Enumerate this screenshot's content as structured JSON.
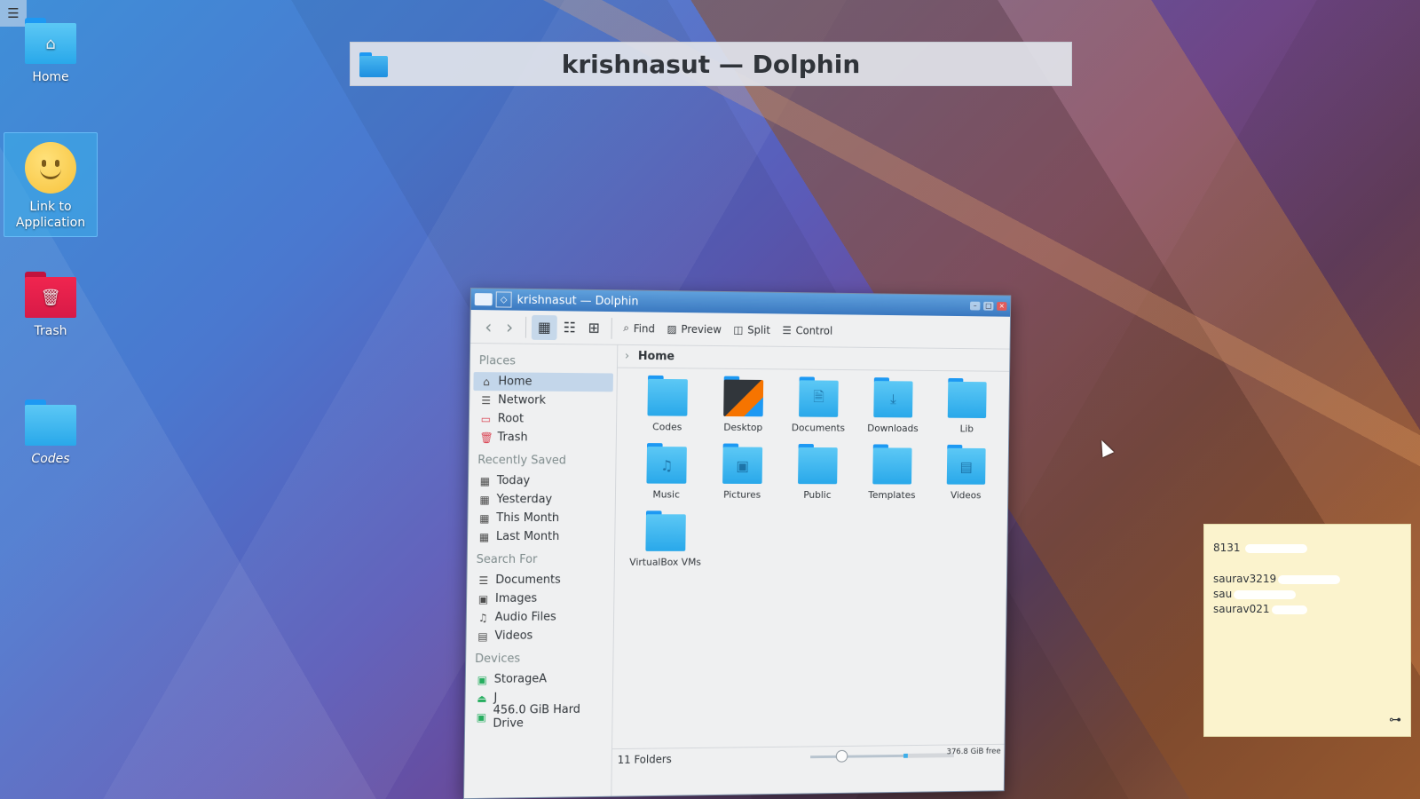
{
  "desktop": {
    "menu_icon": "hamburger-icon",
    "icons": [
      {
        "label": "Home",
        "icon": "home-folder-icon"
      },
      {
        "label": "Link to Application",
        "icon": "smiley-icon"
      },
      {
        "label": "Trash",
        "icon": "trash-folder-icon"
      },
      {
        "label": "Codes",
        "icon": "link-folder-icon"
      }
    ]
  },
  "switcher": {
    "title": "krishnasut — Dolphin",
    "icon": "folder-icon"
  },
  "window": {
    "title": "krishnasut — Dolphin",
    "toolbar": {
      "back": "back-arrow-icon",
      "forward": "forward-arrow-icon",
      "find": "Find",
      "preview": "Preview",
      "split": "Split",
      "control": "Control"
    },
    "places": {
      "header": "Places",
      "items": [
        "Home",
        "Network",
        "Root",
        "Trash"
      ],
      "recent_header": "Recently Saved",
      "recent": [
        "Today",
        "Yesterday",
        "This Month",
        "Last Month"
      ],
      "search_header": "Search For",
      "search": [
        "Documents",
        "Images",
        "Audio Files",
        "Videos"
      ],
      "devices_header": "Devices",
      "devices": [
        "StorageA",
        "J",
        "456.0 GiB Hard Drive"
      ]
    },
    "breadcrumb": {
      "current": "Home"
    },
    "folders": [
      {
        "name": "Codes",
        "glyph": ""
      },
      {
        "name": "Desktop",
        "glyph": ""
      },
      {
        "name": "Documents",
        "glyph": "🗎"
      },
      {
        "name": "Downloads",
        "glyph": "⤓"
      },
      {
        "name": "Lib",
        "glyph": ""
      },
      {
        "name": "Music",
        "glyph": "♫"
      },
      {
        "name": "Pictures",
        "glyph": "▣"
      },
      {
        "name": "Public",
        "glyph": ""
      },
      {
        "name": "Templates",
        "glyph": ""
      },
      {
        "name": "Videos",
        "glyph": "▤"
      },
      {
        "name": "VirtualBox VMs",
        "glyph": ""
      }
    ],
    "status": {
      "count": "11 Folders",
      "free": "376.8 GiB free"
    }
  },
  "note": {
    "lines": [
      "8131 ",
      "saurav3219",
      "sau",
      "saurav021"
    ]
  },
  "colors": {
    "accent": "#3daee9",
    "folder_blue": "#29a8ea",
    "trash_red": "#d81a47",
    "note_bg": "#fbf3cd"
  }
}
